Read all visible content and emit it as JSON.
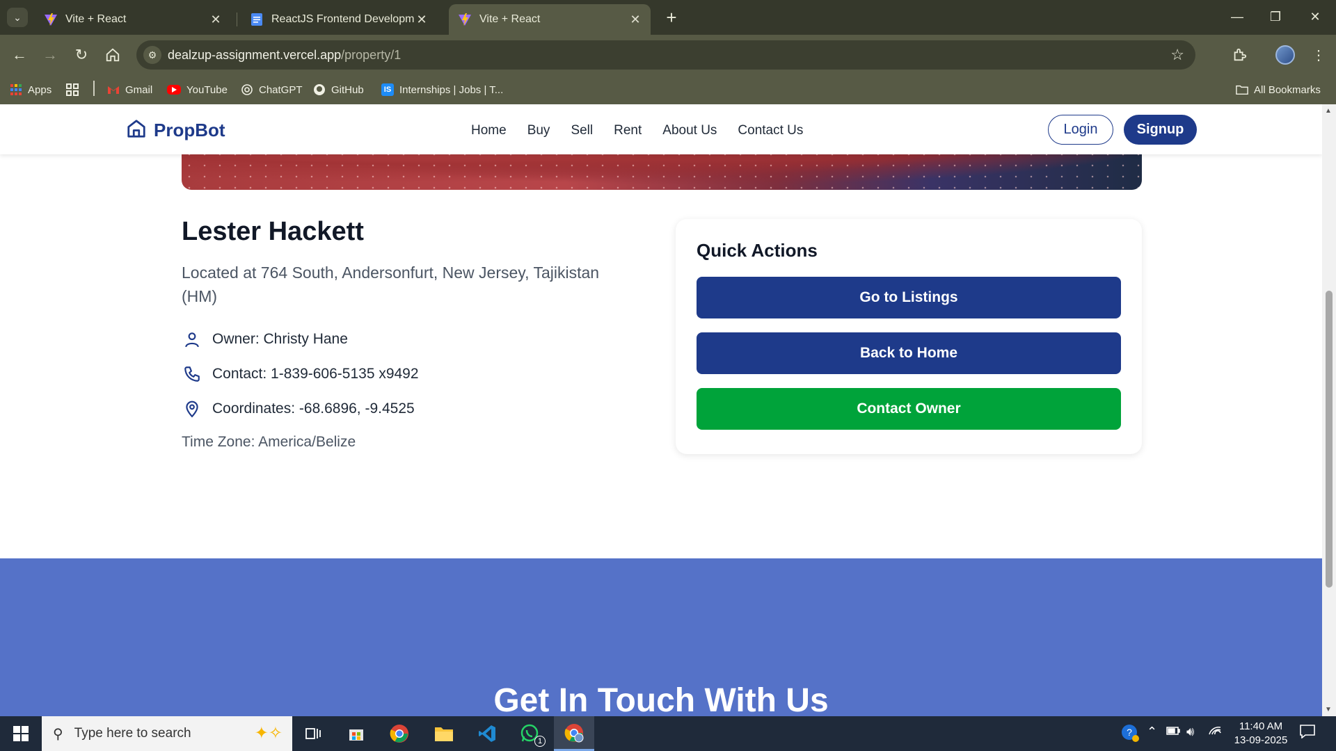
{
  "browser": {
    "tabs": [
      {
        "title": "Vite + React",
        "active": false
      },
      {
        "title": "ReactJS Frontend Development",
        "active": false
      },
      {
        "title": "Vite + React",
        "active": true
      }
    ],
    "url_host": "dealzup-assignment.vercel.app",
    "url_path": "/property/1",
    "bookmarks": [
      {
        "label": "Apps",
        "icon": "apps-grid-icon"
      },
      {
        "label": "Gmail",
        "icon": "gmail-icon"
      },
      {
        "label": "YouTube",
        "icon": "youtube-icon"
      },
      {
        "label": "ChatGPT",
        "icon": "chatgpt-icon"
      },
      {
        "label": "GitHub",
        "icon": "github-icon"
      },
      {
        "label": "Internships | Jobs | T...",
        "icon": "internshala-icon"
      }
    ],
    "all_bookmarks_label": "All Bookmarks"
  },
  "site": {
    "brand": "PropBot",
    "nav": [
      "Home",
      "Buy",
      "Sell",
      "Rent",
      "About Us",
      "Contact Us"
    ],
    "login_label": "Login",
    "signup_label": "Signup",
    "brand_color": "#1e3a8a"
  },
  "property": {
    "name": "Lester Hackett",
    "address": "Located at 764 South, Andersonfurt, New Jersey, Tajikistan (HM)",
    "owner": "Owner: Christy Hane",
    "contact": "Contact: 1-839-606-5135 x9492",
    "coordinates": "Coordinates: -68.6896, -9.4525",
    "timezone": "Time Zone: America/Belize"
  },
  "quick_actions": {
    "title": "Quick Actions",
    "go_to_listings": "Go to Listings",
    "back_to_home": "Back to Home",
    "contact_owner": "Contact Owner",
    "primary_color": "#1e3a8a",
    "success_color": "#00a33a"
  },
  "contact_section": {
    "heading": "Get In Touch With Us",
    "background": "#5572c8"
  },
  "taskbar": {
    "search_placeholder": "Type here to search",
    "time": "11:40 AM",
    "date": "13-09-2025",
    "whatsapp_badge": "1"
  }
}
